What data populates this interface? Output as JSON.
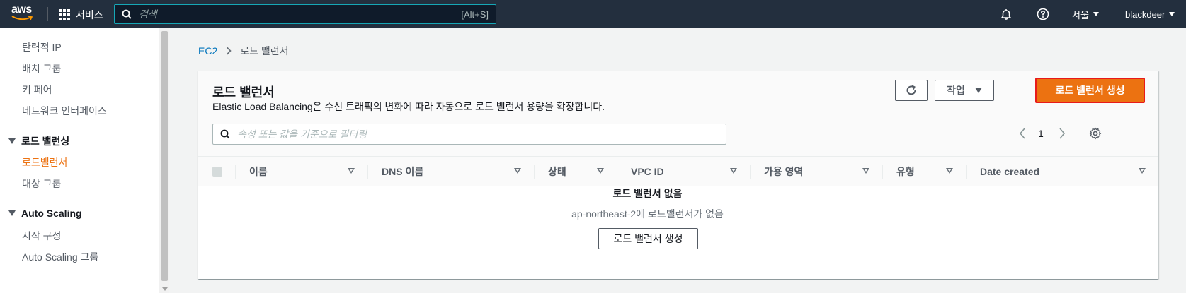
{
  "topnav": {
    "logo": "aws",
    "services_label": "서비스",
    "search_placeholder": "검색",
    "search_shortcut": "[Alt+S]",
    "region": "서울",
    "account": "blackdeer",
    "icons": [
      "grid-icon",
      "search-icon",
      "bell-icon",
      "help-icon"
    ]
  },
  "sidebar": {
    "items": [
      {
        "label": "탄력적 IP"
      },
      {
        "label": "배치 그룹"
      },
      {
        "label": "키 페어"
      },
      {
        "label": "네트워크 인터페이스"
      }
    ],
    "sections": [
      {
        "title": "로드 밸런싱",
        "items": [
          {
            "label": "로드밸런서",
            "active": true
          },
          {
            "label": "대상 그룹"
          }
        ]
      },
      {
        "title": "Auto Scaling",
        "items": [
          {
            "label": "시작 구성"
          },
          {
            "label": "Auto Scaling 그룹"
          }
        ]
      }
    ]
  },
  "breadcrumb": {
    "root": "EC2",
    "current": "로드 밸런서"
  },
  "panel": {
    "title": "로드 밸런서",
    "description": "Elastic Load Balancing은 수신 트래픽의 변화에 따라 자동으로 로드 밸런서 용량을 확장합니다.",
    "actions_label": "작업",
    "create_label": "로드 밸런서 생성",
    "filter_placeholder": "속성 또는 값을 기준으로 필터링",
    "page": "1"
  },
  "table": {
    "columns": [
      "이름",
      "DNS 이름",
      "상태",
      "VPC ID",
      "가용 영역",
      "유형",
      "Date created"
    ]
  },
  "empty": {
    "title": "로드 밸런서 없음",
    "subtitle": "ap-northeast-2에 로드밸런서가 없음",
    "button": "로드 밸런서 생성"
  },
  "colors": {
    "nav_bg": "#232f3e",
    "primary": "#ec7211",
    "link": "#0073bb",
    "highlight_border": "#e81a1a"
  }
}
